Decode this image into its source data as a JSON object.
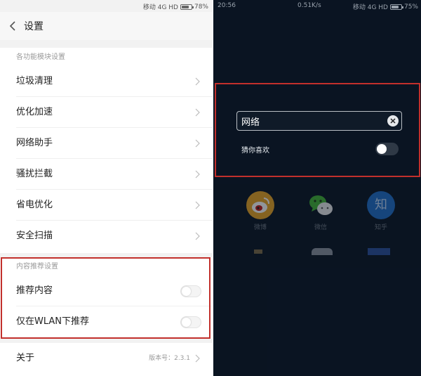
{
  "left_panel": {
    "status_bar": {
      "carrier": "移动 4G HD",
      "battery": "78%",
      "battery_level": 0.78
    },
    "header": {
      "title": "设置"
    },
    "sections": [
      {
        "title": "各功能模块设置",
        "items": [
          {
            "label": "垃圾清理"
          },
          {
            "label": "优化加速"
          },
          {
            "label": "网络助手"
          },
          {
            "label": "骚扰拦截"
          },
          {
            "label": "省电优化"
          },
          {
            "label": "安全扫描"
          }
        ]
      },
      {
        "title": "内容推荐设置",
        "items": [
          {
            "label": "推荐内容",
            "toggle": false
          },
          {
            "label": "仅在WLAN下推荐",
            "toggle": false
          }
        ]
      }
    ],
    "about": {
      "label": "关于",
      "version": "版本号：2.3.1"
    }
  },
  "right_panel": {
    "status_bar": {
      "time": "20:56",
      "speed": "0.51K/s",
      "carrier": "移动 4G HD",
      "battery": "75%",
      "battery_level": 0.75
    },
    "search": {
      "value": "网络"
    },
    "suggest": {
      "label": "猜你喜欢",
      "toggle": false
    },
    "apps": [
      {
        "name": "微博",
        "icon": "weibo-icon"
      },
      {
        "name": "微信",
        "icon": "wechat-icon"
      },
      {
        "name": "知乎",
        "icon": "zhihu-icon",
        "glyph": "知"
      }
    ]
  },
  "colors": {
    "highlight": "#c2302c",
    "left_bg": "#f2f2f2",
    "right_bg": "#0a1422",
    "weibo": "#e9a422",
    "wechat": "#43b233",
    "zhihu": "#1f6dc6"
  }
}
